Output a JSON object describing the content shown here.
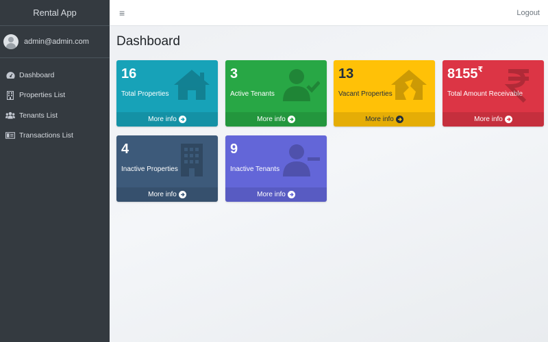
{
  "brand": {
    "title": "Rental App"
  },
  "user": {
    "email": "admin@admin.com"
  },
  "sidebar": {
    "items": [
      {
        "label": "Dashboard",
        "icon": "dashboard-icon"
      },
      {
        "label": "Properties List",
        "icon": "building-icon"
      },
      {
        "label": "Tenants List",
        "icon": "users-icon"
      },
      {
        "label": "Transactions List",
        "icon": "money-icon"
      }
    ]
  },
  "topbar": {
    "menu_icon": "≡",
    "logout_label": "Logout"
  },
  "page": {
    "title": "Dashboard"
  },
  "cards": [
    {
      "value": "16",
      "label": "Total Properties",
      "footer": "More info",
      "color": "#17a2b8",
      "icon": "house-icon"
    },
    {
      "value": "3",
      "label": "Active Tenants",
      "footer": "More info",
      "color": "#28a745",
      "icon": "user-check-icon"
    },
    {
      "value": "13",
      "label": "Vacant Properties",
      "footer": "More info",
      "color": "#ffc107",
      "icon": "house-damage-icon"
    },
    {
      "value": "8155",
      "currency": "₹",
      "label": "Total Amount Receivable",
      "footer": "More info",
      "color": "#dc3545",
      "icon": "rupee-icon"
    },
    {
      "value": "4",
      "label": "Inactive Properties",
      "footer": "More info",
      "color": "#3d5a7a",
      "icon": "building-icon"
    },
    {
      "value": "9",
      "label": "Inactive Tenants",
      "footer": "More info",
      "color": "#6366d8",
      "icon": "user-minus-icon"
    }
  ]
}
